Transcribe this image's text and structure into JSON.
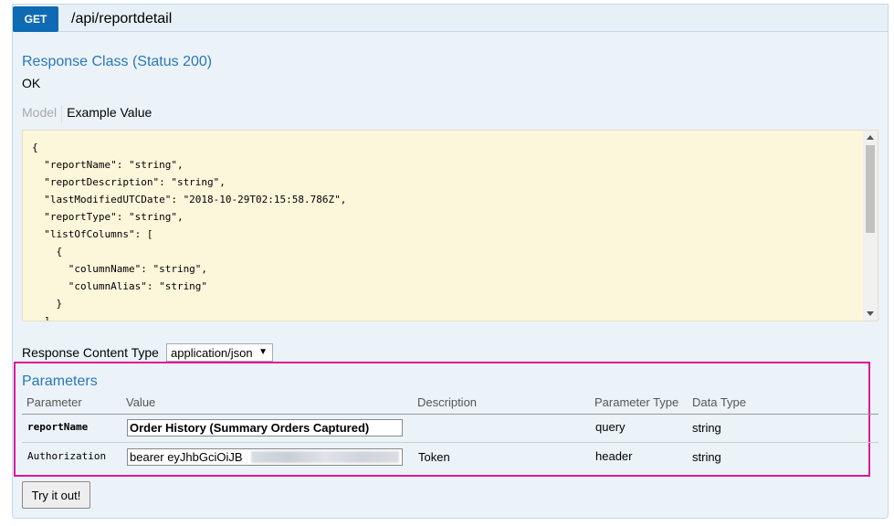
{
  "endpoint": {
    "method": "GET",
    "path": "/api/reportdetail"
  },
  "response": {
    "class_title": "Response Class (Status 200)",
    "status_text": "OK",
    "tabs": [
      "Model",
      "Example Value"
    ],
    "example_json": "{\n  \"reportName\": \"string\",\n  \"reportDescription\": \"string\",\n  \"lastModifiedUTCDate\": \"2018-10-29T02:15:58.786Z\",\n  \"reportType\": \"string\",\n  \"listOfColumns\": [\n    {\n      \"columnName\": \"string\",\n      \"columnAlias\": \"string\"\n    }\n  ]"
  },
  "content_type": {
    "label": "Response Content Type",
    "selected": "application/json"
  },
  "parameters": {
    "title": "Parameters",
    "headers": [
      "Parameter",
      "Value",
      "Description",
      "Parameter Type",
      "Data Type"
    ],
    "rows": [
      {
        "name": "reportName",
        "value": "Order History (Summary Orders Captured)",
        "description": "",
        "param_type": "query",
        "data_type": "string"
      },
      {
        "name": "Authorization",
        "value": "bearer eyJhbGciOiJB",
        "description": "Token",
        "param_type": "header",
        "data_type": "string"
      }
    ]
  },
  "actions": {
    "try_label": "Try it out!"
  }
}
